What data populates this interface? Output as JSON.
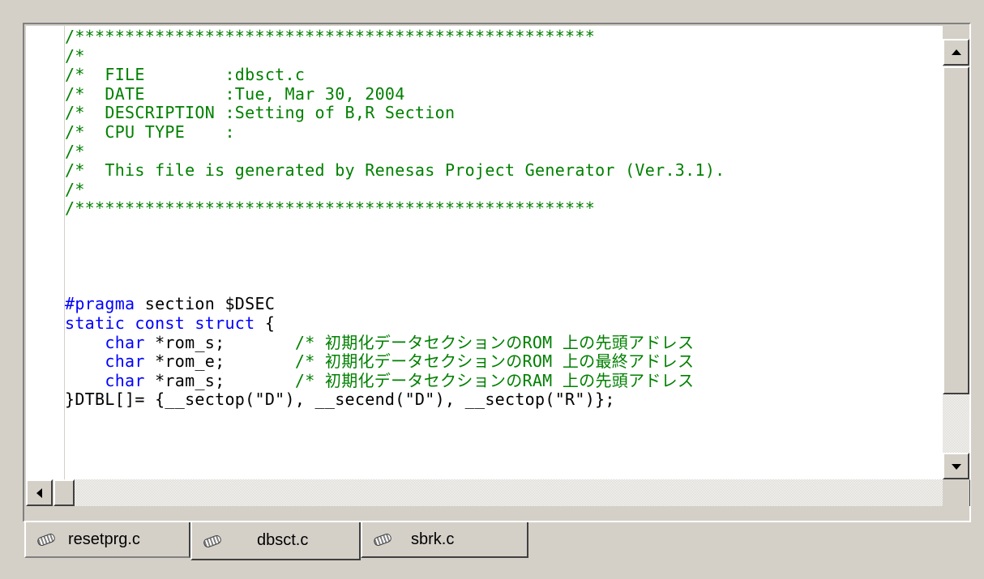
{
  "editor": {
    "lines": [
      {
        "segments": [
          {
            "text": "/****************************************************",
            "style": "comment"
          }
        ]
      },
      {
        "segments": [
          {
            "text": "/*",
            "style": "comment"
          }
        ]
      },
      {
        "segments": [
          {
            "text": "/*  FILE        :dbsct.c",
            "style": "comment"
          }
        ]
      },
      {
        "segments": [
          {
            "text": "/*  DATE        :Tue, Mar 30, 2004",
            "style": "comment"
          }
        ]
      },
      {
        "segments": [
          {
            "text": "/*  DESCRIPTION :Setting of B,R Section",
            "style": "comment"
          }
        ]
      },
      {
        "segments": [
          {
            "text": "/*  CPU TYPE    :",
            "style": "comment"
          }
        ]
      },
      {
        "segments": [
          {
            "text": "/*",
            "style": "comment"
          }
        ]
      },
      {
        "segments": [
          {
            "text": "/*  This file is generated by Renesas Project Generator (Ver.3.1).",
            "style": "comment"
          }
        ]
      },
      {
        "segments": [
          {
            "text": "/*",
            "style": "comment"
          }
        ]
      },
      {
        "segments": [
          {
            "text": "/****************************************************",
            "style": "comment"
          }
        ]
      },
      {
        "segments": [
          {
            "text": "",
            "style": "text"
          }
        ]
      },
      {
        "segments": [
          {
            "text": "",
            "style": "text"
          }
        ]
      },
      {
        "segments": [
          {
            "text": "",
            "style": "text"
          }
        ]
      },
      {
        "segments": [
          {
            "text": "",
            "style": "text"
          }
        ]
      },
      {
        "segments": [
          {
            "text": "#pragma",
            "style": "keyword"
          },
          {
            "text": " section $DSEC",
            "style": "text"
          }
        ]
      },
      {
        "segments": [
          {
            "text": "static const struct",
            "style": "keyword"
          },
          {
            "text": " {",
            "style": "text"
          }
        ]
      },
      {
        "segments": [
          {
            "text": "    ",
            "style": "text"
          },
          {
            "text": "char",
            "style": "keyword"
          },
          {
            "text": " *rom_s;       ",
            "style": "text"
          },
          {
            "text": "/* 初期化データセクションのROM 上の先頭アドレス",
            "style": "comment"
          }
        ]
      },
      {
        "segments": [
          {
            "text": "    ",
            "style": "text"
          },
          {
            "text": "char",
            "style": "keyword"
          },
          {
            "text": " *rom_e;       ",
            "style": "text"
          },
          {
            "text": "/* 初期化データセクションのROM 上の最終アドレス",
            "style": "comment"
          }
        ]
      },
      {
        "segments": [
          {
            "text": "    ",
            "style": "text"
          },
          {
            "text": "char",
            "style": "keyword"
          },
          {
            "text": " *ram_s;       ",
            "style": "text"
          },
          {
            "text": "/* 初期化データセクションのRAM 上の先頭アドレス",
            "style": "comment"
          }
        ]
      },
      {
        "segments": [
          {
            "text": "}DTBL[]= {__sectop(\"D\"), __secend(\"D\"), __sectop(\"R\")};",
            "style": "text"
          }
        ]
      }
    ]
  },
  "tabs": [
    {
      "label": "resetprg.c",
      "icon": "file-icon",
      "active": false
    },
    {
      "label": "dbsct.c",
      "icon": "file-icon",
      "active": true
    },
    {
      "label": "sbrk.c",
      "icon": "file-icon",
      "active": false
    }
  ],
  "colors": {
    "comment": "#008000",
    "keyword": "#0000ff",
    "text": "#000000"
  }
}
